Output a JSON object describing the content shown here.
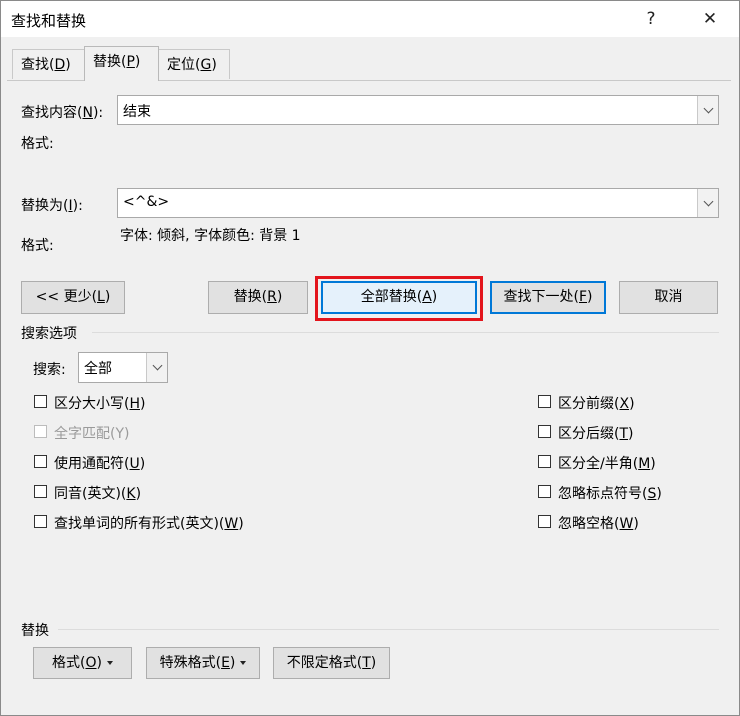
{
  "window": {
    "title": "查找和替换",
    "help": "?",
    "close": "✕"
  },
  "tabs": [
    {
      "pre": "查找(",
      "key": "D",
      "post": ")"
    },
    {
      "pre": "替换(",
      "key": "P",
      "post": ")"
    },
    {
      "pre": "定位(",
      "key": "G",
      "post": ")"
    }
  ],
  "find": {
    "label_pre": "查找内容(",
    "label_key": "N",
    "label_post": "):",
    "value": "结束",
    "format_label": "格式:"
  },
  "replace": {
    "label_pre": "替换为(",
    "label_key": "I",
    "label_post": "):",
    "value": "<^&>",
    "format_label": "格式:",
    "format_value": "字体: 倾斜, 字体颜色: 背景 1"
  },
  "buttons": {
    "less": {
      "pre": "<< 更少(",
      "key": "L",
      "post": ")"
    },
    "replace": {
      "pre": "替换(",
      "key": "R",
      "post": ")"
    },
    "replace_all": {
      "pre": "全部替换(",
      "key": "A",
      "post": ")"
    },
    "find_next": {
      "pre": "查找下一处(",
      "key": "F",
      "post": ")"
    },
    "cancel": "取消"
  },
  "search_options": {
    "heading": "搜索选项",
    "search_label": "搜索:",
    "search_value": "全部",
    "left": [
      {
        "pre": "区分大小写(",
        "key": "H",
        "post": ")",
        "checked": false,
        "disabled": false
      },
      {
        "pre": "全字匹配(",
        "key": "Y",
        "post": ")",
        "checked": false,
        "disabled": true
      },
      {
        "pre": "使用通配符(",
        "key": "U",
        "post": ")",
        "checked": false,
        "disabled": false
      },
      {
        "pre": "同音(英文)(",
        "key": "K",
        "post": ")",
        "checked": false,
        "disabled": false
      },
      {
        "pre": "查找单词的所有形式(英文)(",
        "key": "W",
        "post": ")",
        "checked": false,
        "disabled": false
      }
    ],
    "right": [
      {
        "pre": "区分前缀(",
        "key": "X",
        "post": ")",
        "checked": false
      },
      {
        "pre": "区分后缀(",
        "key": "T",
        "post": ")",
        "checked": false
      },
      {
        "pre": "区分全/半角(",
        "key": "M",
        "post": ")",
        "checked": false
      },
      {
        "pre": "忽略标点符号(",
        "key": "S",
        "post": ")",
        "checked": false
      },
      {
        "pre": "忽略空格(",
        "key": "W",
        "post": ")",
        "checked": false
      }
    ]
  },
  "replace_section": {
    "heading": "替换",
    "format": {
      "pre": "格式(",
      "key": "O",
      "post": ")"
    },
    "special": {
      "pre": "特殊格式(",
      "key": "E",
      "post": ")"
    },
    "no_format": {
      "pre": "不限定格式(",
      "key": "T",
      "post": ")"
    }
  }
}
